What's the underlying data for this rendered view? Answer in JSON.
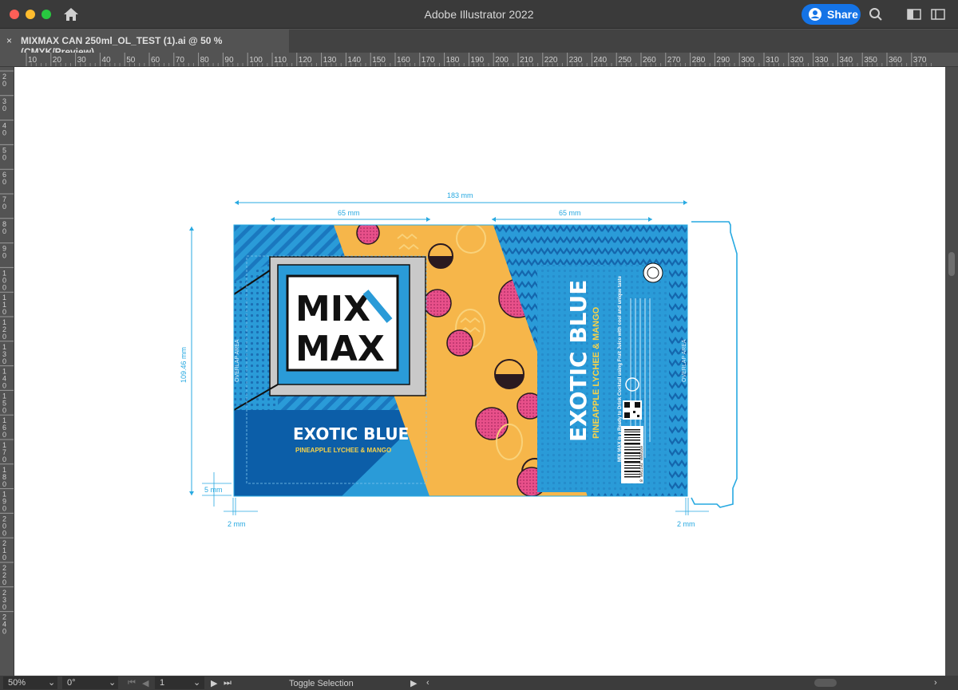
{
  "app": {
    "title": "Adobe Illustrator 2022",
    "share_label": "Share"
  },
  "document_tab": {
    "close": "×",
    "name": "MIXMAX CAN 250ml_OL_TEST (1).ai @ 50 % (CMYK/Preview)"
  },
  "ruler_top_labels": [
    "10",
    "20",
    "30",
    "40",
    "50",
    "60",
    "70",
    "80",
    "90",
    "100",
    "110",
    "120",
    "130",
    "140",
    "150",
    "160",
    "170",
    "180",
    "190",
    "200",
    "210",
    "220",
    "230",
    "240",
    "250",
    "260",
    "270",
    "280",
    "290",
    "300",
    "310",
    "320",
    "330",
    "340",
    "350",
    "360",
    "370"
  ],
  "ruler_left_labels": [
    "20",
    "30",
    "40",
    "50",
    "60",
    "70",
    "80",
    "90",
    "100",
    "110",
    "120",
    "130",
    "140",
    "150",
    "160",
    "170",
    "180",
    "190",
    "200",
    "210",
    "220",
    "230",
    "240"
  ],
  "artwork": {
    "dimensions": {
      "total_width": "183 mm",
      "panel_left": "65 mm",
      "panel_right": "65 mm",
      "height": "109.46 mm",
      "bottom_margin": "5 mm",
      "left_margin": "2 mm",
      "right_margin": "2 mm"
    },
    "brand_line1": "MIX",
    "brand_line2": "MAX",
    "flavor_name": "EXOTIC BLUE",
    "flavor_sub": "PINEAPPLE LYCHEE & MANGO",
    "vertical_name": "EXOTIC BLUE",
    "vertical_sub": "PINEAPPLE LYCHEE & MANGO",
    "description": "MIX MAX is a Ready to Drink Cocktail using Fruit Juice with cool and unique taste",
    "barcode": "8 991102 880169",
    "overlap_label": "OVERLAP AREA",
    "colors": {
      "can_blue": "#2a9bd8",
      "dark_blue": "#0c5ea8",
      "orange": "#f6b64a",
      "pink": "#e8508a",
      "dim_line": "#27a9e1"
    }
  },
  "status": {
    "zoom": "50%",
    "rotation": "0°",
    "artboard": "1",
    "tool": "Toggle Selection"
  }
}
